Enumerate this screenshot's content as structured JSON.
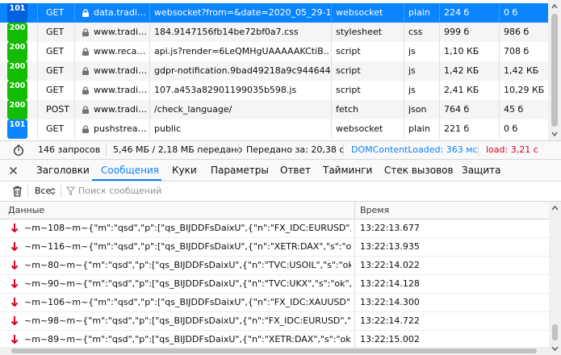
{
  "requests": [
    {
      "status": "101",
      "method": "GET",
      "domain": "data.tradi…",
      "file": "websocket?from=&date=2020_05_29-1…",
      "cause": "websocket",
      "type": "plain",
      "transferred": "224 б",
      "size": "0 б"
    },
    {
      "status": "200",
      "method": "GET",
      "domain": "www.tradi…",
      "file": "184.9147156fb14be72bf0a7.css",
      "cause": "stylesheet",
      "type": "css",
      "transferred": "999 б",
      "size": "986 б"
    },
    {
      "status": "200",
      "method": "GET",
      "domain": "www.reca…",
      "file": "api.js?render=6LeQMHgUAAAAAKCtiB…",
      "cause": "script",
      "type": "js",
      "transferred": "1,10 КБ",
      "size": "708 б"
    },
    {
      "status": "200",
      "method": "GET",
      "domain": "www.tradi…",
      "file": "gdpr-notification.9bad49218a9c944644…",
      "cause": "script",
      "type": "js",
      "transferred": "1,42 КБ",
      "size": "1,42 КБ"
    },
    {
      "status": "200",
      "method": "GET",
      "domain": "www.tradi…",
      "file": "107.a453a82901199035b598.js",
      "cause": "script",
      "type": "js",
      "transferred": "2,41 КБ",
      "size": "10,29 КБ"
    },
    {
      "status": "200",
      "method": "POST",
      "domain": "www.tradi…",
      "file": "/check_language/",
      "cause": "fetch",
      "type": "json",
      "transferred": "764 б",
      "size": "45 б"
    },
    {
      "status": "101",
      "method": "GET",
      "domain": "pushstrea…",
      "file": "public",
      "cause": "websocket",
      "type": "plain",
      "transferred": "221 б",
      "size": "0 б"
    }
  ],
  "summary": {
    "requests": "146 запросов",
    "transferred": "5,46 МБ / 2,18 МБ передано",
    "finish": "Передано за: 20,38 с",
    "domcontent": "DOMContentLoaded: 363 мс",
    "load": "load: 3,21 с",
    "colors": {
      "dom": "#0a84ff",
      "load": "#d70022"
    }
  },
  "tabs": [
    "Заголовки",
    "Сообщения",
    "Куки",
    "Параметры",
    "Ответ",
    "Тайминги",
    "Стек вызовов",
    "Защита"
  ],
  "active_tab": "Сообщения",
  "toolbar": {
    "filter_select": "Все",
    "filter_placeholder": "Поиск сообщений"
  },
  "messages_header": {
    "data": "Данные",
    "time": "Время"
  },
  "messages": [
    {
      "data": "~m~108~m~{\"m\":\"qsd\",\"p\":[\"qs_BIJDDFsDaixU\",{\"n\":\"FX_IDC:EURUSD\",\"s\":\"ok\",…",
      "time": "13:22:13.677"
    },
    {
      "data": "~m~116~m~{\"m\":\"qsd\",\"p\":[\"qs_BIJDDFsDaixU\",{\"n\":\"XETR:DAX\",\"s\":\"ok\",\"v\":{\"vol…",
      "time": "13:22:13.935"
    },
    {
      "data": "~m~80~m~{\"m\":\"qsd\",\"p\":[\"qs_BIJDDFsDaixU\",{\"n\":\"TVC:USOIL\",\"s\":\"ok\",\"v\":{\"lp…",
      "time": "13:22:14.022"
    },
    {
      "data": "~m~90~m~{\"m\":\"qsd\",\"p\":[\"qs_BIJDDFsDaixU\",{\"n\":\"TVC:UKX\",\"s\":\"ok\",\"v\":{\"lp\":6…",
      "time": "13:22:14.128"
    },
    {
      "data": "~m~106~m~{\"m\":\"qsd\",\"p\":[\"qs_BIJDDFsDaixU\",{\"n\":\"FX_IDC:XAUUSD\",\"s\":\"ok\",…",
      "time": "13:22:14.300"
    },
    {
      "data": "~m~98~m~{\"m\":\"qsd\",\"p\":[\"qs_BIJDDFsDaixU\",{\"n\":\"FX_IDC:EURUSD\",\"s\":\"ok\",…",
      "time": "13:22:14.722"
    },
    {
      "data": "~m~89~m~{\"m\":\"qsd\",\"p\":[\"qs_BIJDDFsDaixU\",{\"n\":\"XETR:DAX\",\"s\":\"ok\",\"v\":{\"vol…",
      "time": "13:22:15.002"
    }
  ]
}
